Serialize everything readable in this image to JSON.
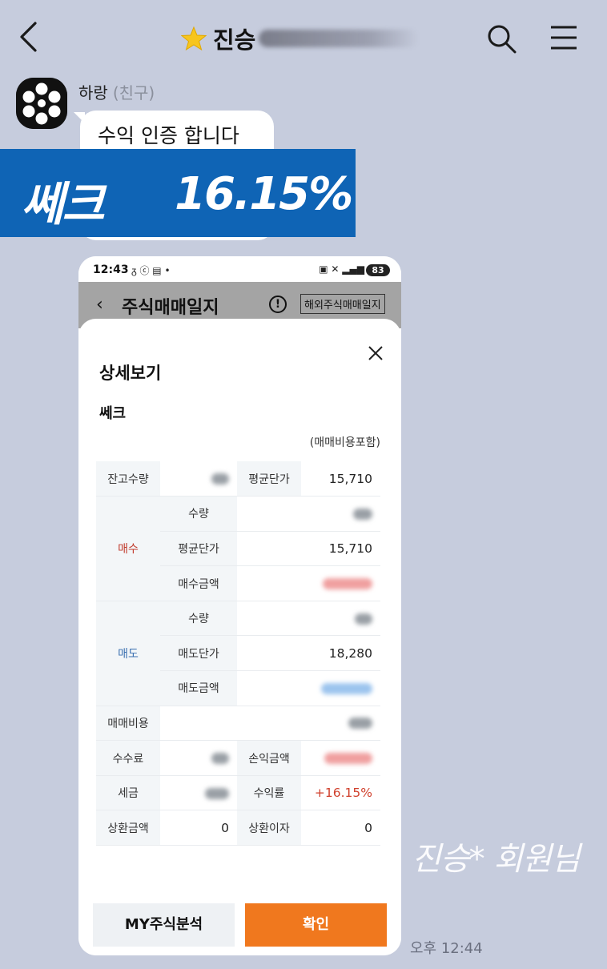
{
  "header": {
    "title": "진승",
    "back_icon": "chevron-left-icon",
    "star_icon": "star-icon",
    "search_icon": "search-icon",
    "menu_icon": "menu-icon"
  },
  "message": {
    "sender_name": "하랑",
    "sender_tag": "(친구)",
    "text": "수익 인증 합니다",
    "time": "오후 12:44"
  },
  "banner": {
    "stock": "쎄크",
    "return": "16.15%",
    "color": "#0f64b5"
  },
  "phone": {
    "status_time": "12:43",
    "battery": "83",
    "app_title": "주식매매일지",
    "overseas_button": "해외주식매매일지"
  },
  "sheet": {
    "title": "상세보기",
    "stock_name": "쎄크",
    "fee_note": "(매매비용포함)",
    "rows": {
      "balance_qty_label": "잔고수량",
      "avg_price_label": "평균단가",
      "avg_price_value": "15,710",
      "buy_label": "매수",
      "buy_qty_label": "수량",
      "buy_avg_label": "평균단가",
      "buy_avg_value": "15,710",
      "buy_amount_label": "매수금액",
      "sell_label": "매도",
      "sell_qty_label": "수량",
      "sell_price_label": "매도단가",
      "sell_price_value": "18,280",
      "sell_amount_label": "매도금액",
      "trade_cost_label": "매매비용",
      "commission_label": "수수료",
      "pl_amount_label": "손익금액",
      "tax_label": "세금",
      "return_label": "수익률",
      "return_value": "+16.15%",
      "repay_amount_label": "상환금액",
      "repay_amount_value": "0",
      "repay_interest_label": "상환이자",
      "repay_interest_value": "0"
    },
    "btn_my": "MY주식분석",
    "btn_ok": "확인"
  },
  "watermark": "진승* 회원님",
  "colors": {
    "background": "#c6ccdd",
    "confirm": "#f0781e",
    "buy": "#c0392b",
    "sell": "#3a6fb0"
  }
}
